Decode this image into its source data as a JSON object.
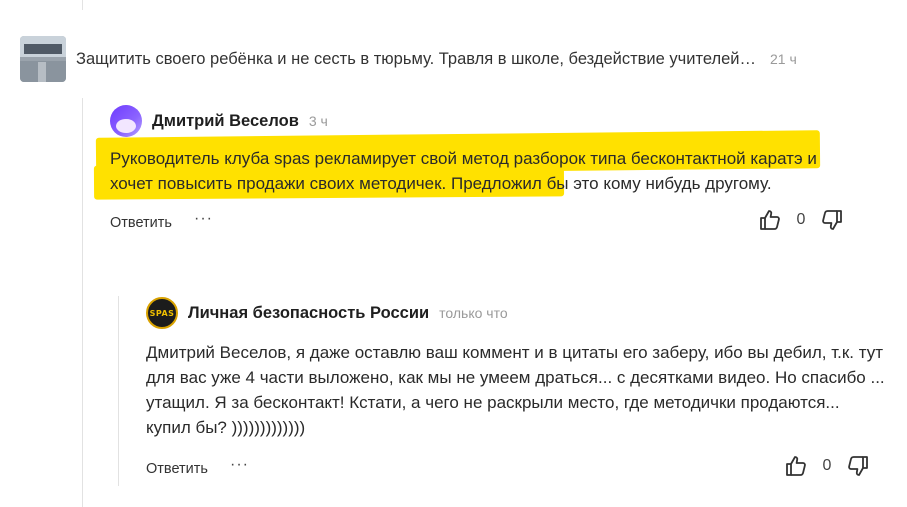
{
  "article": {
    "title": "Защитить своего ребёнка и не сесть в тюрьму. Травля в школе, бездействие учителей…",
    "time": "21 ч"
  },
  "comments": [
    {
      "author": "Дмитрий Веселов",
      "time": "3 ч",
      "text": "Руководитель клуба spas рекламирует свой метод разборок типа бесконтактной каратэ и хочет повысить продажи своих методичек. Предложил бы это кому нибудь другому.",
      "reply_label": "Ответить",
      "more_label": "···",
      "votes": "0",
      "highlight_color": "#ffe100"
    },
    {
      "author": "Личная безопасность России",
      "time": "только что",
      "avatar_text": "SPAS",
      "text": "Дмитрий Веселов, я даже оставлю ваш коммент и в цитаты его заберу, ибо вы дебил, т.к. тут для вас уже 4 части выложено, как мы не умеем драться... с десятками видео. Но спасибо ... утащил. Я за бесконтакт! Кстати, а чего не раскрыли место, где методички продаются... купил бы? )))))))))))))",
      "reply_label": "Ответить",
      "more_label": "···",
      "votes": "0"
    }
  ],
  "icons": {
    "like": "thumb-up-icon",
    "dislike": "thumb-down-icon"
  }
}
